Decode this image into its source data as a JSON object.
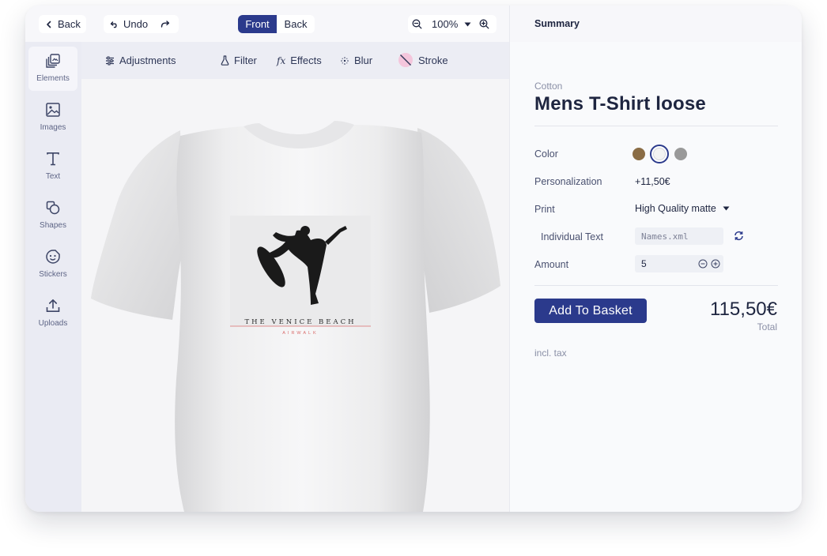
{
  "topbar": {
    "back_label": "Back",
    "undo_label": "Undo",
    "side_options": [
      "Front",
      "Back"
    ],
    "active_side": "Front",
    "zoom": "100%"
  },
  "sidebar": {
    "items": [
      {
        "label": "Elements",
        "icon": "elements-icon"
      },
      {
        "label": "Images",
        "icon": "image-icon"
      },
      {
        "label": "Text",
        "icon": "text-icon"
      },
      {
        "label": "Shapes",
        "icon": "shapes-icon"
      },
      {
        "label": "Stickers",
        "icon": "sticker-icon"
      },
      {
        "label": "Uploads",
        "icon": "upload-icon"
      }
    ],
    "active": "Elements"
  },
  "toolbar": {
    "items": [
      {
        "label": "Adjustments",
        "icon": "sliders-icon"
      },
      {
        "label": "Filter",
        "icon": "flask-icon"
      },
      {
        "label": "Effects",
        "icon": "fx-icon"
      },
      {
        "label": "Blur",
        "icon": "blur-icon"
      },
      {
        "label": "Stroke",
        "icon": "stroke-icon"
      }
    ]
  },
  "design": {
    "print_title": "THE VENICE BEACH",
    "print_subtitle": "AIRWALK",
    "accent_color": "#d96b6b"
  },
  "summary": {
    "header": "Summary",
    "material": "Cotton",
    "product_name": "Mens T-Shirt loose",
    "color_label": "Color",
    "swatches": [
      "#8a6c45",
      "#f3f3f3",
      "#999999"
    ],
    "selected_swatch": "#f3f3f3",
    "personalization_label": "Personalization",
    "personalization_price": "+11,50€",
    "print_label": "Print",
    "print_value": "High Quality matte",
    "individual_text_label": "Individual Text",
    "individual_text_placeholder": "Names.xml",
    "amount_label": "Amount",
    "amount_value": "5",
    "add_button": "Add To Basket",
    "price": "115,50€",
    "total_label": "Total",
    "tax_note": "incl. tax",
    "primary_color": "#2b3a8c"
  }
}
